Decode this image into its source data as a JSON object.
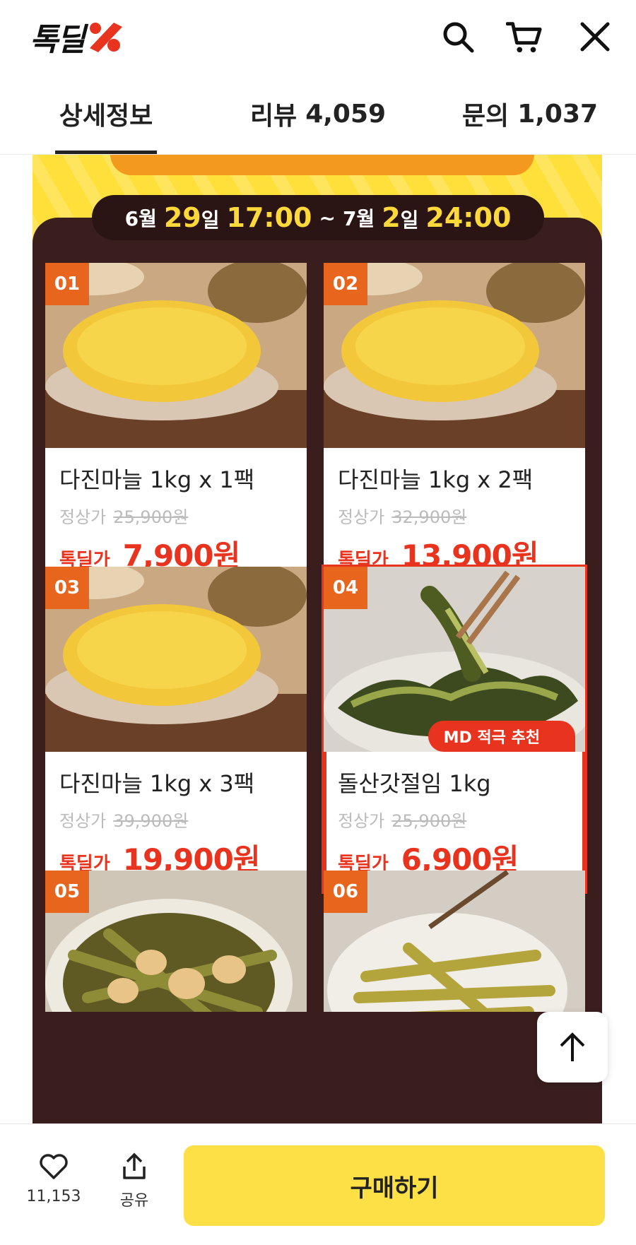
{
  "header": {
    "logo_text": "톡딜",
    "brand_color": "#e8331f",
    "icons": [
      "search-icon",
      "cart-icon",
      "close-icon"
    ]
  },
  "tabs": [
    {
      "label": "상세정보",
      "count": "",
      "active": true
    },
    {
      "label": "리뷰",
      "count": "4,059",
      "active": false
    },
    {
      "label": "문의",
      "count": "1,037",
      "active": false
    }
  ],
  "promo": {
    "date": {
      "start_month": "6월",
      "start_day": "29",
      "start_day_unit": "일",
      "start_time": "17:00",
      "sep": "~",
      "end_month": "7월",
      "end_day": "2",
      "end_day_unit": "일",
      "end_time": "24:00"
    },
    "products": [
      {
        "badge": "01",
        "name": "다진마늘 1kg x 1팩",
        "orig_label": "정상가",
        "orig_price": "25,900원",
        "sale_label": "톡딜가",
        "sale_price": "7,900원"
      },
      {
        "badge": "02",
        "name": "다진마늘 1kg x 2팩",
        "orig_label": "정상가",
        "orig_price": "32,900원",
        "sale_label": "톡딜가",
        "sale_price": "13,900원"
      },
      {
        "badge": "03",
        "name": "다진마늘 1kg x 3팩",
        "orig_label": "정상가",
        "orig_price": "39,900원",
        "sale_label": "톡딜가",
        "sale_price": "19,900원"
      },
      {
        "badge": "04",
        "name": "돌산갓절임 1kg",
        "orig_label": "정상가",
        "orig_price": "25,900원",
        "sale_label": "톡딜가",
        "sale_price": "6,900원",
        "tag": "MD 적극 추천"
      },
      {
        "badge": "05"
      },
      {
        "badge": "06"
      }
    ]
  },
  "bottom": {
    "like_count": "11,153",
    "share_label": "공유",
    "buy_label": "구매하기",
    "buy_color": "#fde045"
  }
}
